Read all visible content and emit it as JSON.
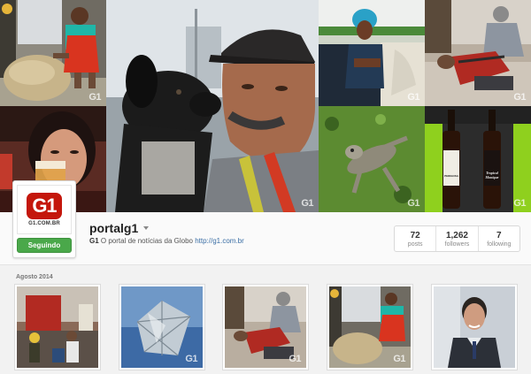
{
  "watermark": "G1",
  "profile": {
    "username": "portalg1",
    "avatar_logo_text": "G1",
    "avatar_site": "G1.COM.BR",
    "follow_label": "Seguindo",
    "bio_brand": "G1",
    "bio_text": "O portal de notícias da Globo",
    "bio_link": "http://g1.com.br"
  },
  "stats": [
    {
      "value": "72",
      "label": "posts"
    },
    {
      "value": "1,262",
      "label": "followers"
    },
    {
      "value": "7",
      "label": "following"
    }
  ],
  "section": {
    "date_label": "Agosto 2014"
  },
  "beer_labels": {
    "left": "PERIGOSA",
    "right": "Tropical Monique"
  },
  "colors": {
    "g1_red": "#c4170c",
    "follow_green": "#4aa84a",
    "link_blue": "#3a6ea5"
  }
}
